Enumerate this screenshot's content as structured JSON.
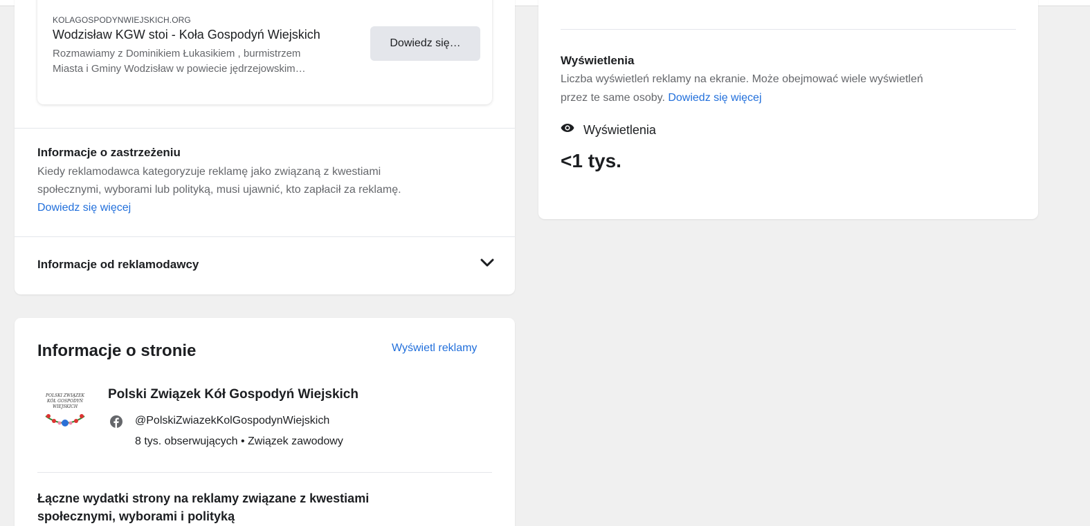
{
  "ad_preview": {
    "domain": "KOLAGOSPODYNWIEJSKICH.ORG",
    "title": "Wodzisław KGW stoi - Koła Gospodyń Wiejskich",
    "description_line1": "Rozmawiamy z Dominikiem Łukasikiem , burmistrzem",
    "description_line2": "Miasta i Gminy Wodzisław w powiecie jędrzejowskim…",
    "cta_label": "Dowiedz się…"
  },
  "disclaimer": {
    "title": "Informacje o zastrzeżeniu",
    "text_line1": "Kiedy reklamodawca kategoryzuje reklamę jako związaną z kwestiami",
    "text_line2": "społecznymi, wyborami lub polityką, musi ujawnić, kto zapłacił za reklamę.",
    "learn_more": "Dowiedz się więcej"
  },
  "advertiser_info": {
    "title": "Informacje od reklamodawcy",
    "chevron_icon": "chevron-down-icon"
  },
  "page_info": {
    "heading": "Informacje o stronie",
    "view_ads_label": "Wyświetl reklamy",
    "page_name": "Polski Związek Kół Gospodyń Wiejskich",
    "avatar_text": "POLSKI ZWIĄZEK KÓŁ GOSPODYŃ WIEJSKICH",
    "handle": "@PolskiZwiazekKolGospodynWiejskich",
    "meta": "8 tys. obserwujących • Związek zawodowy",
    "spend_title_line1": "Łączne wydatki strony na reklamy związane z kwestiami",
    "spend_title_line2": "społecznymi, wyborami i polityką"
  },
  "impressions": {
    "title": "Wyświetlenia",
    "desc_line1": "Liczba wyświetleń reklamy na ekranie. Może obejmować wiele wyświetleń",
    "desc_line2": "przez te same osoby.",
    "learn_more": "Dowiedz się więcej",
    "label": "Wyświetlenia",
    "value": "<1 tys.",
    "icon": "eye-icon"
  },
  "colors": {
    "background": "#f0f0f0",
    "link": "#216fdb",
    "button_bg": "#e4e6eb",
    "facebook": "#65676b"
  }
}
